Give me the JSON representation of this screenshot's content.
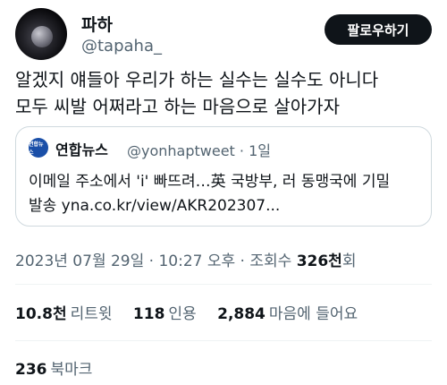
{
  "author": {
    "name": "파하",
    "handle": "@tapaha_"
  },
  "follow_label": "팔로우하기",
  "tweet_text_line1": "알겠지 얘들아 우리가 하는 실수는 실수도 아니다",
  "tweet_text_line2": "모두 씨발 어쩌라고 하는 마음으로 살아가자",
  "quote": {
    "logo_text": "연합뉴스",
    "name": "연합뉴스",
    "handle": "@yonhaptweet · 1일",
    "text_line1": "이메일 주소에서 'i' 빠뜨려…英 국방부, 러 동맹국에 기밀",
    "text_line2": "발송 yna.co.kr/view/AKR202307..."
  },
  "meta": {
    "date": "2023년 07월 29일 · 10:27 오후 · 조회수 ",
    "views": "326천",
    "views_suffix": "회"
  },
  "stats": {
    "retweets": "10.8천",
    "retweets_label": "리트윗",
    "quotes": "118",
    "quotes_label": "인용",
    "likes": "2,884",
    "likes_label": "마음에 들어요"
  },
  "bookmarks": {
    "count": "236",
    "label": "북마크"
  }
}
